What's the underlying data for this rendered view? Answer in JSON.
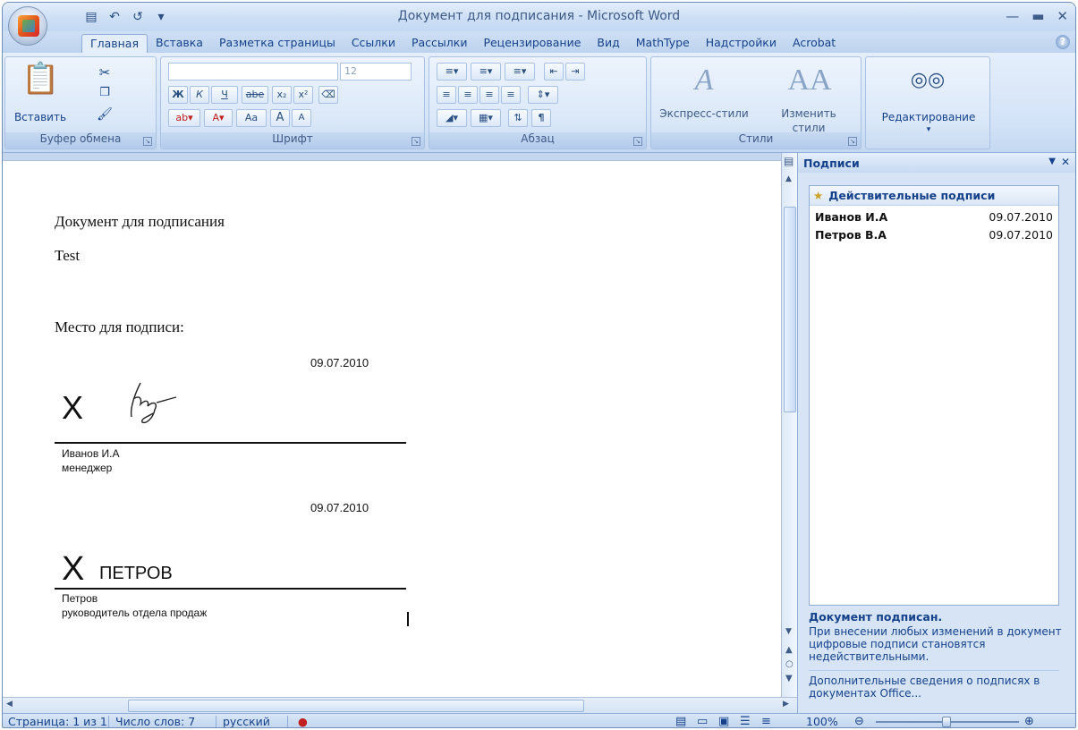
{
  "window": {
    "title": "Документ для подписания - Microsoft Word"
  },
  "tabs": [
    "Главная",
    "Вставка",
    "Разметка страницы",
    "Ссылки",
    "Рассылки",
    "Рецензирование",
    "Вид",
    "MathType",
    "Надстройки",
    "Acrobat"
  ],
  "ribbon": {
    "clipboard": {
      "paste_label": "Вставить",
      "group_label": "Буфер обмена"
    },
    "font": {
      "font_size": "12",
      "group_label": "Шрифт",
      "bold": "Ж",
      "italic": "К",
      "underline": "Ч",
      "strike": "abe",
      "sub": "x₂",
      "sup": "x²",
      "grow": "A",
      "shrink": "A",
      "case": "Aa"
    },
    "paragraph": {
      "group_label": "Абзац",
      "pilcrow": "¶"
    },
    "styles": {
      "express_label": "Экспресс-стили",
      "change_label_1": "Изменить",
      "change_label_2": "стили",
      "group_label": "Стили"
    },
    "editing": {
      "label": "Редактирование"
    }
  },
  "document": {
    "title": "Документ для подписания",
    "test": "Test",
    "place_label": "Место для подписи:",
    "sig1": {
      "date": "09.07.2010",
      "x": "X",
      "name": "Иванов И.А",
      "role": "менеджер"
    },
    "sig2": {
      "date": "09.07.2010",
      "x": "X",
      "typed": "ПЕТРОВ",
      "name": "Петров",
      "role": "руководитель отдела продаж"
    }
  },
  "pane": {
    "title": "Подписи",
    "section": "Действительные подписи",
    "signatures": [
      {
        "name": "Иванов И.А",
        "date": "09.07.2010"
      },
      {
        "name": "Петров В.А",
        "date": "09.07.2010"
      }
    ],
    "note_title": "Документ подписан.",
    "note_text": "При внесении любых изменений в документ цифровые подписи становятся недействительными.",
    "more_info": "Дополнительные сведения о подписях в документах Office..."
  },
  "status": {
    "page": "Страница: 1 из 1",
    "words": "Число слов: 7",
    "language": "русский",
    "zoom": "100%"
  },
  "colors": {
    "ribbon": "#d3e3f7",
    "text": "#15428b"
  }
}
